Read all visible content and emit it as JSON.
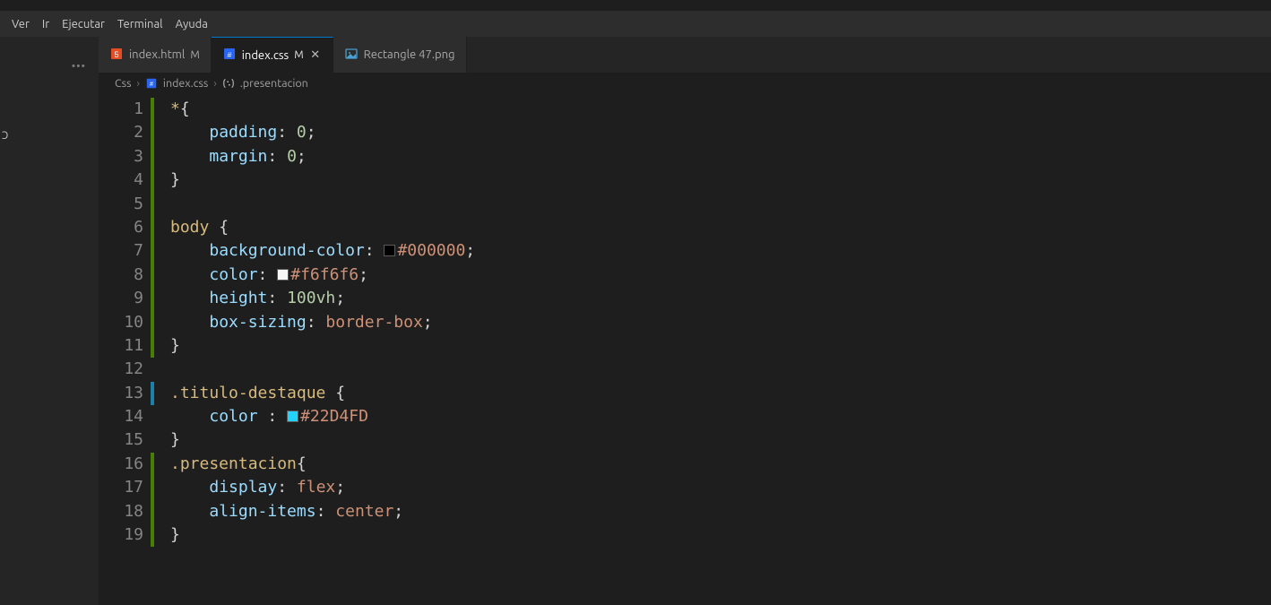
{
  "menu": {
    "items": [
      "Ver",
      "Ir",
      "Ejecutar",
      "Terminal",
      "Ayuda"
    ]
  },
  "sidebar": {
    "overflow_icon": "···",
    "bottom_glyph": "ɔ"
  },
  "tabs": [
    {
      "icon": "html",
      "label": "index.html",
      "mod": "M",
      "active": false,
      "closeable": false
    },
    {
      "icon": "css",
      "label": "index.css",
      "mod": "M",
      "active": true,
      "closeable": true
    },
    {
      "icon": "img",
      "label": "Rectangle 47.png",
      "mod": "",
      "active": false,
      "closeable": false
    }
  ],
  "breadcrumb": {
    "seg1": "Css",
    "seg2_icon": "css",
    "seg2": "index.css",
    "seg3_icon": "brackets",
    "seg3": ".presentacion"
  },
  "code": {
    "lines": [
      {
        "n": 1,
        "git": "green",
        "html": "<span class='tok-sel'>*</span><span class='tok-punc'>{</span>"
      },
      {
        "n": 2,
        "git": "green",
        "html": "    <span class='tok-prop'>padding</span><span class='tok-punc'>: </span><span class='tok-num'>0</span><span class='tok-punc'>;</span>"
      },
      {
        "n": 3,
        "git": "green",
        "html": "    <span class='tok-prop'>margin</span><span class='tok-punc'>: </span><span class='tok-num'>0</span><span class='tok-punc'>;</span>"
      },
      {
        "n": 4,
        "git": "green",
        "html": "<span class='tok-punc'>}</span>"
      },
      {
        "n": 5,
        "git": "green",
        "html": ""
      },
      {
        "n": 6,
        "git": "green",
        "html": "<span class='tok-sel'>body</span> <span class='tok-punc'>{</span>"
      },
      {
        "n": 7,
        "git": "green",
        "html": "    <span class='tok-prop'>background-color</span><span class='tok-punc'>: </span><span class='color-swatch' style='background:#000000'></span><span class='tok-val'>#000000</span><span class='tok-punc'>;</span>"
      },
      {
        "n": 8,
        "git": "green",
        "html": "    <span class='tok-prop'>color</span><span class='tok-punc'>: </span><span class='color-swatch' style='background:#f6f6f6'></span><span class='tok-val'>#f6f6f6</span><span class='tok-punc'>;</span>"
      },
      {
        "n": 9,
        "git": "green",
        "html": "    <span class='tok-prop'>height</span><span class='tok-punc'>: </span><span class='tok-num'>100vh</span><span class='tok-punc'>;</span>"
      },
      {
        "n": 10,
        "git": "green",
        "html": "    <span class='tok-prop'>box-sizing</span><span class='tok-punc'>: </span><span class='tok-val'>border-box</span><span class='tok-punc'>;</span>"
      },
      {
        "n": 11,
        "git": "green",
        "html": "<span class='tok-punc'>}</span>"
      },
      {
        "n": 12,
        "git": "",
        "html": ""
      },
      {
        "n": 13,
        "git": "blue",
        "html": "<span class='tok-sel'>.titulo-destaque</span> <span class='tok-punc'>{</span>"
      },
      {
        "n": 14,
        "git": "",
        "html": "    <span class='tok-prop'>color</span> <span class='tok-punc'>: </span><span class='color-swatch' style='background:#22D4FD'></span><span class='tok-val'>#22D4FD</span>"
      },
      {
        "n": 15,
        "git": "",
        "html": "<span class='tok-punc'>}</span>"
      },
      {
        "n": 16,
        "git": "green",
        "html": "<span class='tok-sel'>.presentacion</span><span class='tok-punc'>{</span>"
      },
      {
        "n": 17,
        "git": "green",
        "html": "    <span class='tok-prop'>display</span><span class='tok-punc'>: </span><span class='tok-val'>flex</span><span class='tok-punc'>;</span>"
      },
      {
        "n": 18,
        "git": "green",
        "html": "    <span class='tok-prop'>align-items</span><span class='tok-punc'>: </span><span class='tok-val'>center</span><span class='tok-punc'>;</span>"
      },
      {
        "n": 19,
        "git": "green",
        "html": "<span class='tok-punc'>}</span>"
      }
    ]
  },
  "colors": {
    "accent": "#007acc",
    "html_icon": "#e44d26",
    "css_icon": "#2965f1",
    "img_icon": "#4aa0d0"
  }
}
